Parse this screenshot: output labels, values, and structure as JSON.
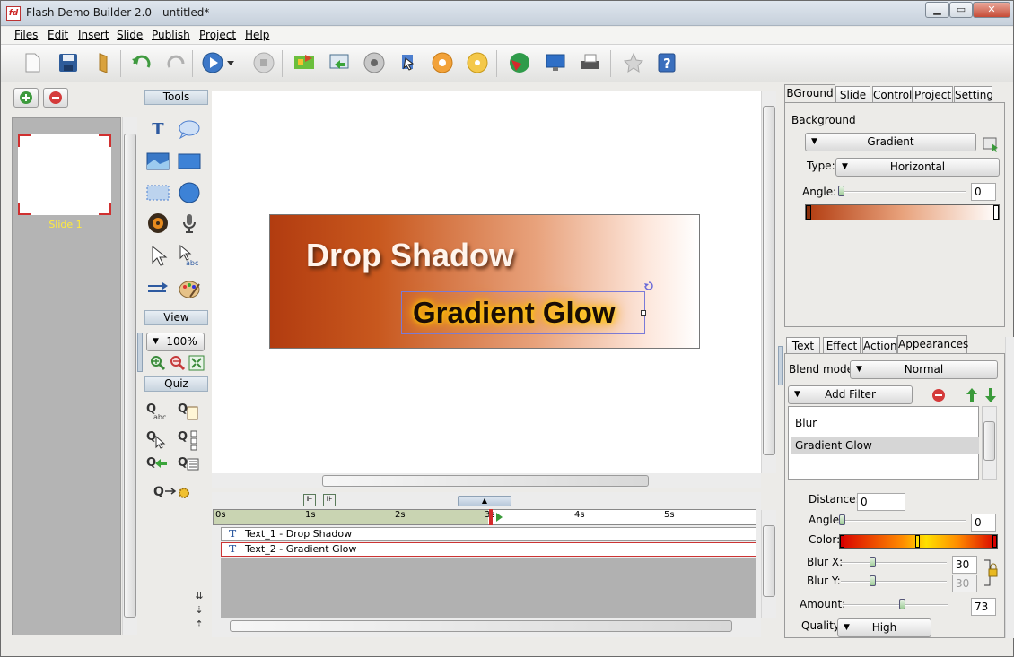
{
  "window": {
    "title": "Flash Demo Builder 2.0 - untitled*"
  },
  "menu": [
    "Files",
    "Edit",
    "Insert",
    "Slide",
    "Publish",
    "Project",
    "Help"
  ],
  "slides": {
    "items": [
      {
        "label": "Slide 1"
      }
    ]
  },
  "tools": {
    "tools_header": "Tools",
    "view_header": "View",
    "zoom": "100%",
    "quiz_header": "Quiz"
  },
  "canvas": {
    "text1": "Drop Shadow",
    "text2": "Gradient Glow"
  },
  "timeline": {
    "ticks": [
      "0s",
      "1s",
      "2s",
      "3s",
      "4s",
      "5s"
    ],
    "rows": [
      {
        "label": "Text_1 - Drop Shadow"
      },
      {
        "label": "Text_2 - Gradient Glow"
      }
    ]
  },
  "props": {
    "tabs": [
      "BGround",
      "Slide",
      "Control",
      "Project",
      "Setting"
    ],
    "background_label": "Background",
    "fill": "Gradient",
    "type_label": "Type:",
    "type": "Horizontal",
    "angle_label": "Angle:",
    "angle": "0",
    "colors": {
      "gradient_start": "#b23c10",
      "gradient_end": "#ffffff"
    }
  },
  "filters": {
    "tabs": [
      "Text",
      "Effect",
      "Action",
      "Appearances"
    ],
    "blend_label": "Blend mode:",
    "blend": "Normal",
    "add_filter": "Add Filter",
    "list": [
      "Blur",
      "Gradient Glow"
    ],
    "distance_label": "Distance:",
    "distance": "0",
    "angle_label": "Angle:",
    "angle": "0",
    "color_label": "Color:",
    "blurx_label": "Blur X:",
    "blurx": "30",
    "blury_label": "Blur Y:",
    "blury": "30",
    "amount_label": "Amount:",
    "amount": "73",
    "quality_label": "Quality:",
    "quality": "High"
  }
}
